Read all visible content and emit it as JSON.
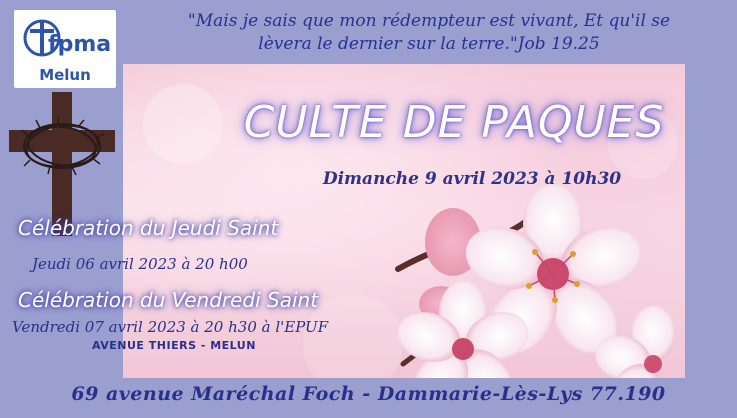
{
  "logo": {
    "letters": "fpma",
    "city": "Melun"
  },
  "quote": {
    "line1": "\"Mais je sais que mon rédempteur est vivant, Et qu'il se",
    "line2": "lèvera le dernier sur la terre.\"Job 19.25"
  },
  "main_event": {
    "title": "CULTE DE PAQUES",
    "date": "Dimanche 9 avril 2023 à 10h30"
  },
  "events": [
    {
      "title": "Célébration  du Jeudi Saint",
      "date": "Jeudi  06 avril 2023 à 20 h00"
    },
    {
      "title": "Célébration  du Vendredi  Saint",
      "date": "Vendredi  07 avril 2023 à 20 h30 à l'EPUF"
    }
  ],
  "venue": "AVENUE THIERS - MELUN",
  "footer": {
    "address": "69 avenue Maréchal Foch - Dammarie-Lès-Lys 77.190"
  },
  "colors": {
    "background": "#9b9fd0",
    "text_dark_blue": "#2a2f8a",
    "logo_blue": "#2d54a8",
    "cross_brown": "#4a2a24",
    "blossom_pink": "#f4c3d3"
  },
  "icons": [
    "cross-with-crown-of-thorns-icon",
    "cherry-blossom-image",
    "fpma-logo-icon"
  ]
}
